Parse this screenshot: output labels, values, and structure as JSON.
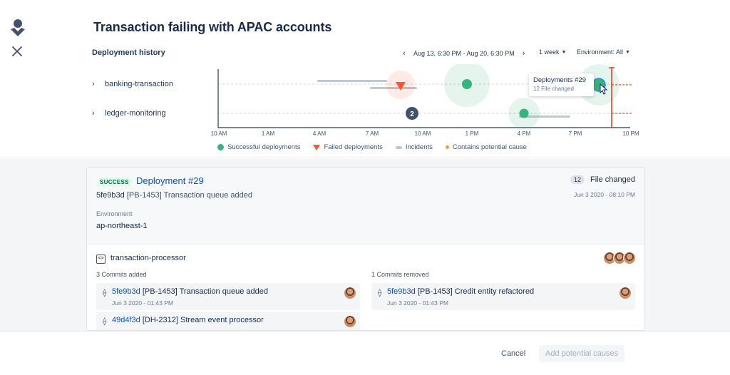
{
  "header": {
    "title": "Transaction failing with APAC accounts"
  },
  "history": {
    "title": "Deployment history",
    "date_range": "Aug 13, 6:30 PM - Aug 20, 6:30 PM",
    "period": "1 week",
    "environment": "Environment: All",
    "rows": [
      {
        "label": "banking-transaction"
      },
      {
        "label": "ledger-monitoring"
      }
    ],
    "x_ticks": [
      "10 AM",
      "1 AM",
      "4 AM",
      "7 AM",
      "10 AM",
      "1 PM",
      "4 PM",
      "7 PM",
      "10 PM"
    ],
    "group_count": "2",
    "tooltip": {
      "title": "Deployments #29",
      "subtitle": "12 File changed"
    },
    "legend": {
      "successful": "Successful deployments",
      "failed": "Failed deployments",
      "incidents": "Incidents",
      "potential": "Contains potential cause"
    },
    "colors": {
      "success": "#36b37e",
      "failed": "#ff5630",
      "incident": "#c1c7d0",
      "potential": "#ff991f",
      "marker": "#de350b"
    }
  },
  "deployment": {
    "status": "SUCCESS",
    "title": "Deployment #29",
    "commit_hash": "5fe9b3d",
    "commit_msg": "[PB-1453] Transaction queue added",
    "env_label": "Environment",
    "env_value": "ap-northeast-1",
    "files_count": "12",
    "files_label": "File changed",
    "date": "Jun 3 2020 - 08:10 PM",
    "repo": "transaction-processor",
    "added_label": "3 Commits added",
    "removed_label": "1 Commits removed",
    "added": [
      {
        "hash": "5fe9b3d",
        "msg": "[PB-1453] Transaction queue added",
        "date": "Jun 3 2020 - 01:43 PM"
      },
      {
        "hash": "49d4f3d",
        "msg": "[DH-2312] Stream event processor",
        "date": ""
      }
    ],
    "removed": [
      {
        "hash": "5fe9b3d",
        "msg": "[PB-1453] Credit entity refactored",
        "date": "Jun 3 2020 - 01:43 PM"
      }
    ]
  },
  "footer": {
    "cancel": "Cancel",
    "add": "Add potential causes"
  }
}
